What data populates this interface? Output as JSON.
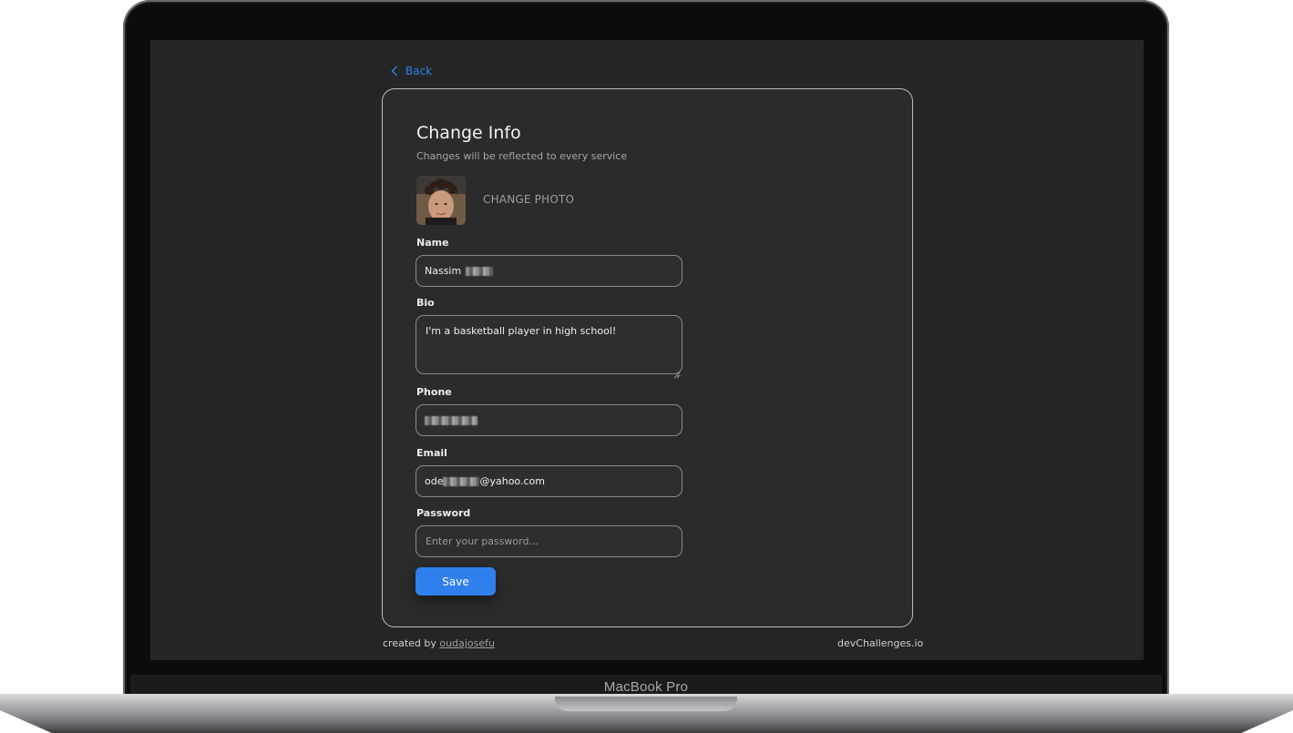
{
  "device": {
    "model_label": "MacBook Pro"
  },
  "nav": {
    "back_label": "Back"
  },
  "card": {
    "title": "Change Info",
    "subtitle": "Changes will be reflected to every service",
    "change_photo_label": "CHANGE PHOTO"
  },
  "form": {
    "name": {
      "label": "Name",
      "value_prefix": "Nassim"
    },
    "bio": {
      "label": "Bio",
      "value": "I'm a basketball player in high school!"
    },
    "phone": {
      "label": "Phone"
    },
    "email": {
      "label": "Email",
      "value_prefix": "ode",
      "value_suffix": "@yahoo.com"
    },
    "password": {
      "label": "Password",
      "placeholder": "Enter your password..."
    },
    "save_label": "Save"
  },
  "footer": {
    "created_by": "created by",
    "author": "oudajosefu",
    "site": "devChallenges.io"
  },
  "colors": {
    "accent": "#2f80ed",
    "background": "#252526",
    "card": "#2b2b2c"
  },
  "icons": {
    "back": "chevron-left-icon"
  }
}
